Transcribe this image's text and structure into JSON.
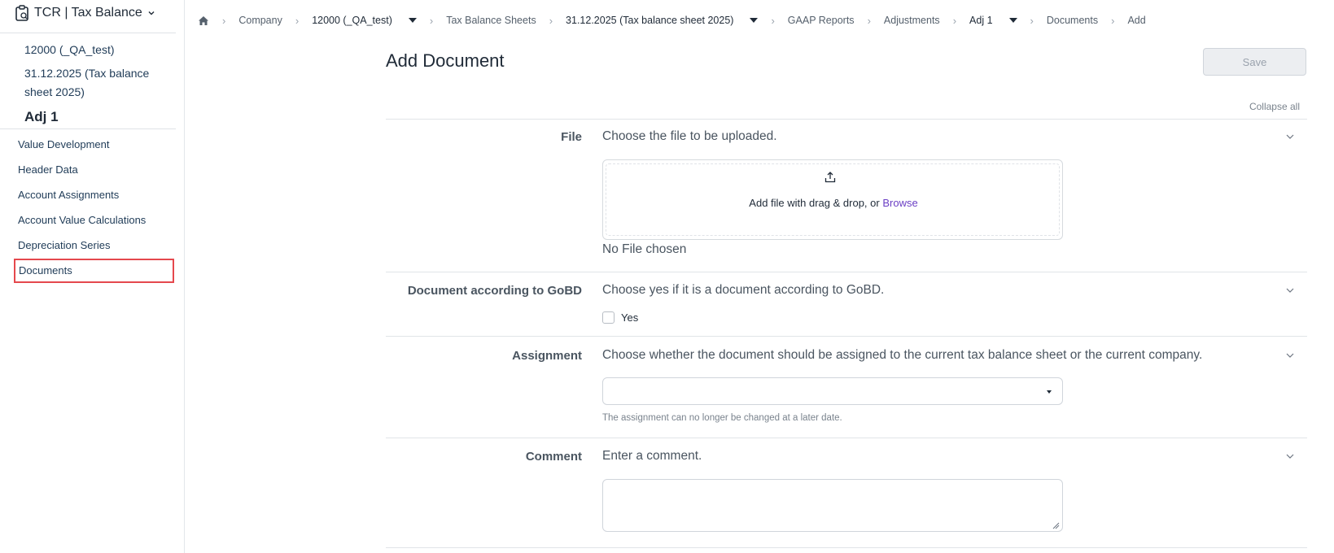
{
  "app": {
    "title": "TCR | Tax Balance"
  },
  "sidebar": {
    "context": {
      "company": "12000 (_QA_test)",
      "sheet_line1": "31.12.2025 (Tax balance",
      "sheet_line2": "sheet 2025)",
      "adjustment": "Adj 1"
    },
    "items": [
      {
        "label": "Value Development"
      },
      {
        "label": "Header Data"
      },
      {
        "label": "Account Assignments"
      },
      {
        "label": "Account Value Calculations"
      },
      {
        "label": "Depreciation Series"
      },
      {
        "label": "Documents",
        "active": true
      }
    ]
  },
  "breadcrumb": [
    {
      "label": "Company"
    },
    {
      "label": "12000 (_QA_test)",
      "dropdown": true
    },
    {
      "label": "Tax Balance Sheets"
    },
    {
      "label": "31.12.2025 (Tax balance sheet 2025)",
      "dropdown": true
    },
    {
      "label": "GAAP Reports"
    },
    {
      "label": "Adjustments"
    },
    {
      "label": "Adj 1",
      "dropdown": true
    },
    {
      "label": "Documents"
    },
    {
      "label": "Add"
    }
  ],
  "page": {
    "title": "Add Document",
    "save_label": "Save",
    "collapse_all_label": "Collapse all"
  },
  "sections": {
    "file": {
      "label": "File",
      "description": "Choose the file to be uploaded.",
      "drop_text": "Add file with drag & drop, or",
      "browse_label": "Browse",
      "no_file": "No File chosen"
    },
    "gobd": {
      "label": "Document according to GoBD",
      "description": "Choose yes if it is a document according to GoBD.",
      "checkbox_label": "Yes",
      "checked": false
    },
    "assignment": {
      "label": "Assignment",
      "description": "Choose whether the document should be assigned to the current tax balance sheet or the current company.",
      "selected_value": "",
      "hint": "The assignment can no longer be changed at a later date."
    },
    "comment": {
      "label": "Comment",
      "description": "Enter a comment.",
      "value": ""
    }
  },
  "colors": {
    "accent_link": "#6b3fc4",
    "active_border": "#e5484d",
    "text_primary": "#1f2a37",
    "text_muted": "#4a5560"
  }
}
